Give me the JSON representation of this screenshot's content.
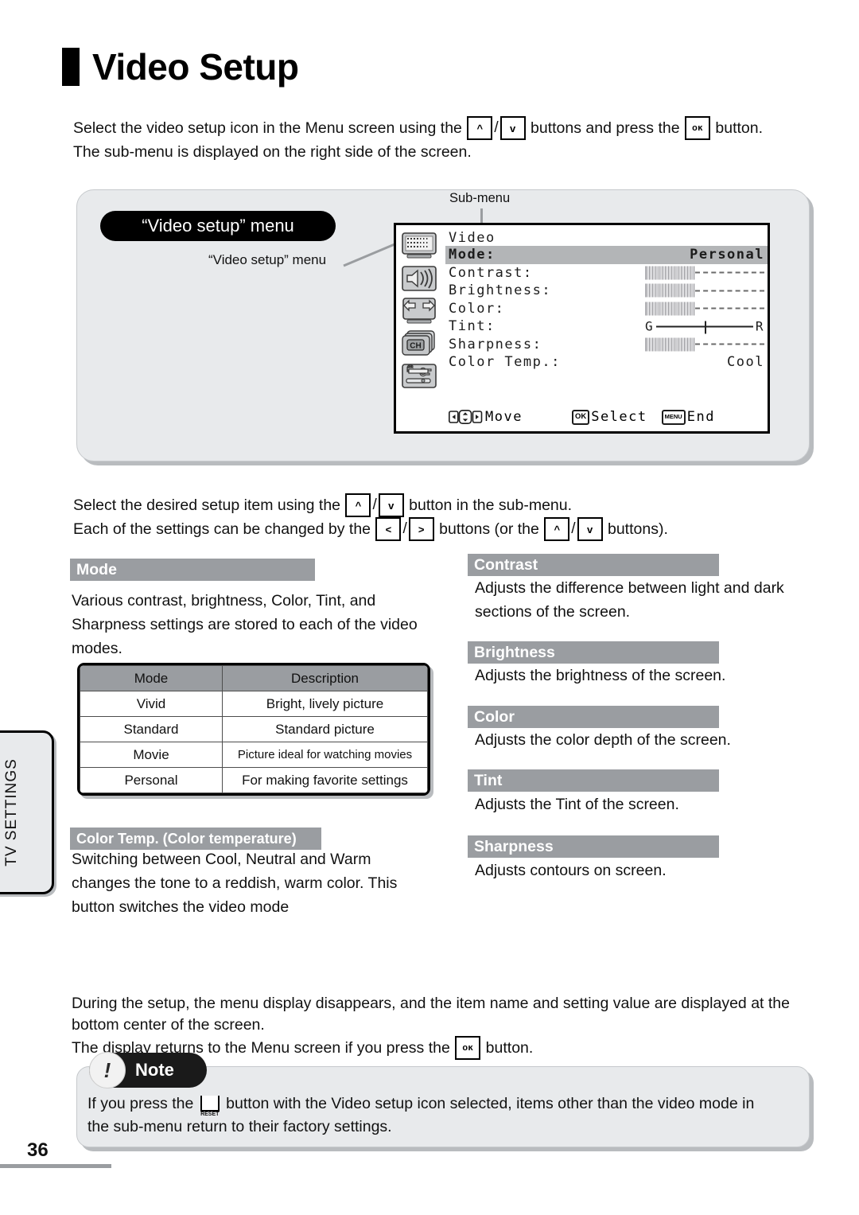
{
  "page": {
    "title": "Video Setup",
    "number": "36",
    "side_tab": "TV SETTINGS"
  },
  "intro": {
    "line1_a": "Select the video setup icon in the Menu screen using the ",
    "key_up": "^",
    "key_sep": "/",
    "key_down": "v",
    "line1_b": " buttons and press the ",
    "key_ok": "oĸ",
    "line1_c": " button.",
    "line2": "The sub-menu is displayed on the right side of the screen."
  },
  "illustration": {
    "bubble": "“Video setup” menu",
    "callout": "“Video setup” menu",
    "submenu_label": "Sub-menu",
    "osd": {
      "title": "Video",
      "rows": [
        {
          "label": "Mode:",
          "value": "Personal",
          "type": "text",
          "selected": true
        },
        {
          "label": "Contrast:",
          "value": "",
          "type": "slider",
          "selected": false
        },
        {
          "label": "Brightness:",
          "value": "",
          "type": "slider",
          "selected": false
        },
        {
          "label": "Color:",
          "value": "",
          "type": "slider",
          "selected": false
        },
        {
          "label": "Tint:",
          "value": "",
          "type": "tint",
          "selected": false,
          "left_mark": "G",
          "right_mark": "R"
        },
        {
          "label": "Sharpness:",
          "value": "",
          "type": "slider",
          "selected": false
        },
        {
          "label": "Color Temp.:",
          "value": "Cool",
          "type": "text",
          "selected": false
        }
      ],
      "footer": {
        "move_label": "Move",
        "ok_pill": "OK",
        "select_label": "Select",
        "menu_pill": "MENU",
        "end_label": "End"
      },
      "icons": [
        "video-icon",
        "audio-icon",
        "screen-icon",
        "channel-icon",
        "setup-icon"
      ]
    }
  },
  "instructions": {
    "line1_a": "Select the desired setup item using the ",
    "line1_b": " button in the sub-menu.",
    "line2_a": "Each of the settings can be changed by the ",
    "key_left": "<",
    "key_right": ">",
    "line2_b": " buttons (or the ",
    "line2_c": " buttons)."
  },
  "sections": {
    "mode": {
      "heading": "Mode",
      "body": "Various contrast, brightness, Color, Tint, and Sharpness settings are stored to each of the video modes.",
      "table": {
        "headers": [
          "Mode",
          "Description"
        ],
        "rows": [
          [
            "Vivid",
            "Bright, lively picture"
          ],
          [
            "Standard",
            "Standard picture"
          ],
          [
            "Movie",
            "Picture ideal for watching movies"
          ],
          [
            "Personal",
            "For making favorite settings"
          ]
        ]
      }
    },
    "color_temp": {
      "heading": "Color Temp. (Color temperature)",
      "body": "Switching between Cool, Neutral and Warm changes the tone to a reddish, warm color. This button switches the video mode"
    },
    "contrast": {
      "heading": "Contrast",
      "body": "Adjusts the difference between light and dark sections of the screen."
    },
    "brightness": {
      "heading": "Brightness",
      "body": "Adjusts the brightness of the screen."
    },
    "color": {
      "heading": "Color",
      "body": "Adjusts the color depth of the screen."
    },
    "tint": {
      "heading": "Tint",
      "body": "Adjusts the Tint of the screen."
    },
    "sharpness": {
      "heading": "Sharpness",
      "body": "Adjusts contours on screen."
    }
  },
  "closing": {
    "line1": "During the setup, the menu display disappears, and the item name and setting value are displayed at the",
    "line2": "bottom center of the screen.",
    "line3_a": "The display returns to the Menu screen if you press the ",
    "line3_b": " button."
  },
  "note": {
    "badge": "Note",
    "text_a": "If you press the ",
    "reset_label": "RESET",
    "text_b": " button with the Video setup icon selected, items other than the video mode in",
    "text_c": "the sub-menu return to their factory settings."
  },
  "colors": {
    "heading_bg": "#9a9da1",
    "panel_bg": "#e8eaec",
    "shadow": "#b9bcbf",
    "ink": "#111111"
  }
}
